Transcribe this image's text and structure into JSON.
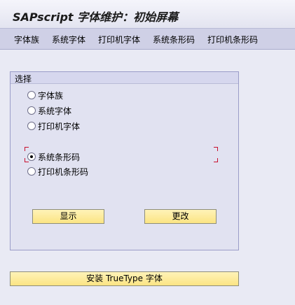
{
  "window": {
    "title": "SAPscript 字体维护：初始屏幕"
  },
  "menu": {
    "items": [
      "字体族",
      "系统字体",
      "打印机字体",
      "系统条形码",
      "打印机条形码"
    ]
  },
  "selection": {
    "title": "选择",
    "options": [
      {
        "label": "字体族",
        "checked": false
      },
      {
        "label": "系统字体",
        "checked": false
      },
      {
        "label": "打印机字体",
        "checked": false
      },
      {
        "label": "系统条形码",
        "checked": true
      },
      {
        "label": "打印机条形码",
        "checked": false
      }
    ]
  },
  "buttons": {
    "display": "显示",
    "change": "更改",
    "install_truetype": "安装 TrueType 字体"
  },
  "colors": {
    "button_fill": "#fbe483",
    "focus_marker": "#c8102e",
    "menubar": "#cfd0e6"
  }
}
